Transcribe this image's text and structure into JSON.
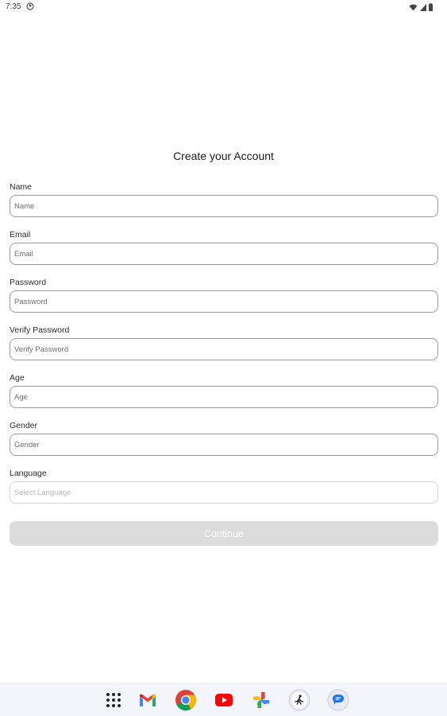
{
  "status_bar": {
    "time": "7:35",
    "icons": [
      "notification-icon",
      "wifi-icon",
      "signal-icon",
      "battery-icon"
    ]
  },
  "form": {
    "title": "Create your Account",
    "fields": [
      {
        "label": "Name",
        "placeholder": "Name",
        "value": ""
      },
      {
        "label": "Email",
        "placeholder": "Email",
        "value": ""
      },
      {
        "label": "Password",
        "placeholder": "Password",
        "value": ""
      },
      {
        "label": "Verify Password",
        "placeholder": "Verify Password",
        "value": ""
      },
      {
        "label": "Age",
        "placeholder": "Age",
        "value": ""
      },
      {
        "label": "Gender",
        "placeholder": "Gender",
        "value": ""
      },
      {
        "label": "Language",
        "placeholder": "Select Language",
        "value": ""
      }
    ],
    "continue_label": "Continue",
    "continue_enabled": false
  },
  "dock": {
    "apps": [
      "app-drawer-icon",
      "gmail-icon",
      "chrome-icon",
      "youtube-icon",
      "photos-icon",
      "app-icon",
      "messages-icon"
    ]
  },
  "colors": {
    "button_disabled": "#dcdcdc",
    "field_border": "#9b9b9b",
    "dock_background": "#f4f5fa"
  }
}
